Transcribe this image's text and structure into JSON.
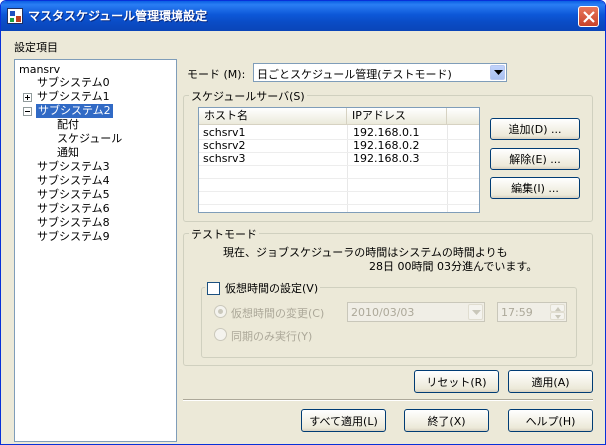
{
  "window": {
    "title": "マスタスケジュール管理環境設定",
    "close_label": "×"
  },
  "settings_label": "設定項目",
  "tree": {
    "root": "mansrv",
    "items": [
      {
        "label": "サブシステム0"
      },
      {
        "label": "サブシステム1",
        "expander": "+"
      },
      {
        "label": "サブシステム2",
        "expander": "−",
        "selected": true
      },
      {
        "label": "配付"
      },
      {
        "label": "スケジュール"
      },
      {
        "label": "通知"
      },
      {
        "label": "サブシステム3"
      },
      {
        "label": "サブシステム4"
      },
      {
        "label": "サブシステム5"
      },
      {
        "label": "サブシステム6"
      },
      {
        "label": "サブシステム8"
      },
      {
        "label": "サブシステム9"
      }
    ]
  },
  "mode": {
    "label": "モード (M):",
    "value": "日ごとスケジュール管理(テストモード)"
  },
  "schedule_servers": {
    "group_title": "スケジュールサーバ(S)",
    "columns": [
      "ホスト名",
      "IPアドレス"
    ],
    "rows": [
      {
        "host": "schsrv1",
        "ip": "192.168.0.1"
      },
      {
        "host": "schsrv2",
        "ip": "192.168.0.2"
      },
      {
        "host": "schsrv3",
        "ip": "192.168.0.3"
      }
    ],
    "add_button": "追加(D) ...",
    "delete_button": "解除(E) ...",
    "edit_button": "編集(I) ..."
  },
  "test_mode": {
    "group_title": "テストモード",
    "message_line1": "現在、ジョブスケジューラの時間はシステムの時間よりも",
    "message_line2": "28日 00時間 03分進んでいます。",
    "virtual_time_checkbox": "仮想時間の設定(V)",
    "change_virtual_time_radio": "仮想時間の変更(C)",
    "sync_only_radio": "同期のみ実行(Y)",
    "date_value": "2010/03/03",
    "time_value": "17:59"
  },
  "buttons": {
    "reset": "リセット(R)",
    "apply": "適用(A)",
    "apply_all": "すべて適用(L)",
    "exit": "終了(X)",
    "help": "ヘルプ(H)"
  }
}
